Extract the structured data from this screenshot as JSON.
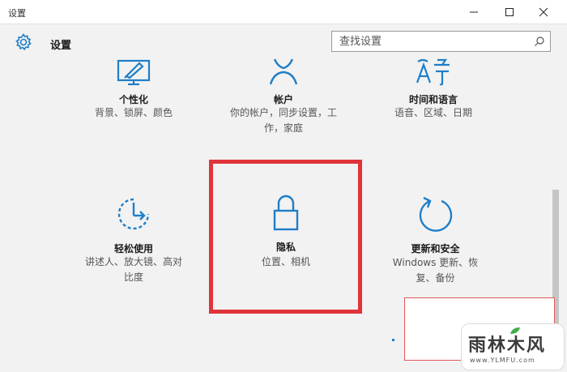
{
  "window": {
    "title": "设置"
  },
  "header": {
    "title": "设置"
  },
  "search": {
    "placeholder": "查找设置"
  },
  "tiles": [
    {
      "name": "个性化",
      "desc": [
        "背景、锁屏、颜色"
      ]
    },
    {
      "name": "帐户",
      "desc": [
        "你的帐户，同步设置，工",
        "作，家庭"
      ]
    },
    {
      "name": "时间和语言",
      "desc": [
        "语音、区域、日期"
      ]
    },
    {
      "name": "轻松使用",
      "desc": [
        "讲述人、放大镜、高对",
        "比度"
      ]
    },
    {
      "name": "隐私",
      "desc": [
        "位置、相机"
      ]
    },
    {
      "name": "更新和安全",
      "desc": [
        "Windows 更新、恢",
        "复、备份"
      ]
    }
  ],
  "watermark": {
    "brand": "雨林木风",
    "url": "www.YLMFU.com"
  },
  "colors": {
    "accent": "#1e7ec8",
    "highlight": "#e0343a"
  }
}
